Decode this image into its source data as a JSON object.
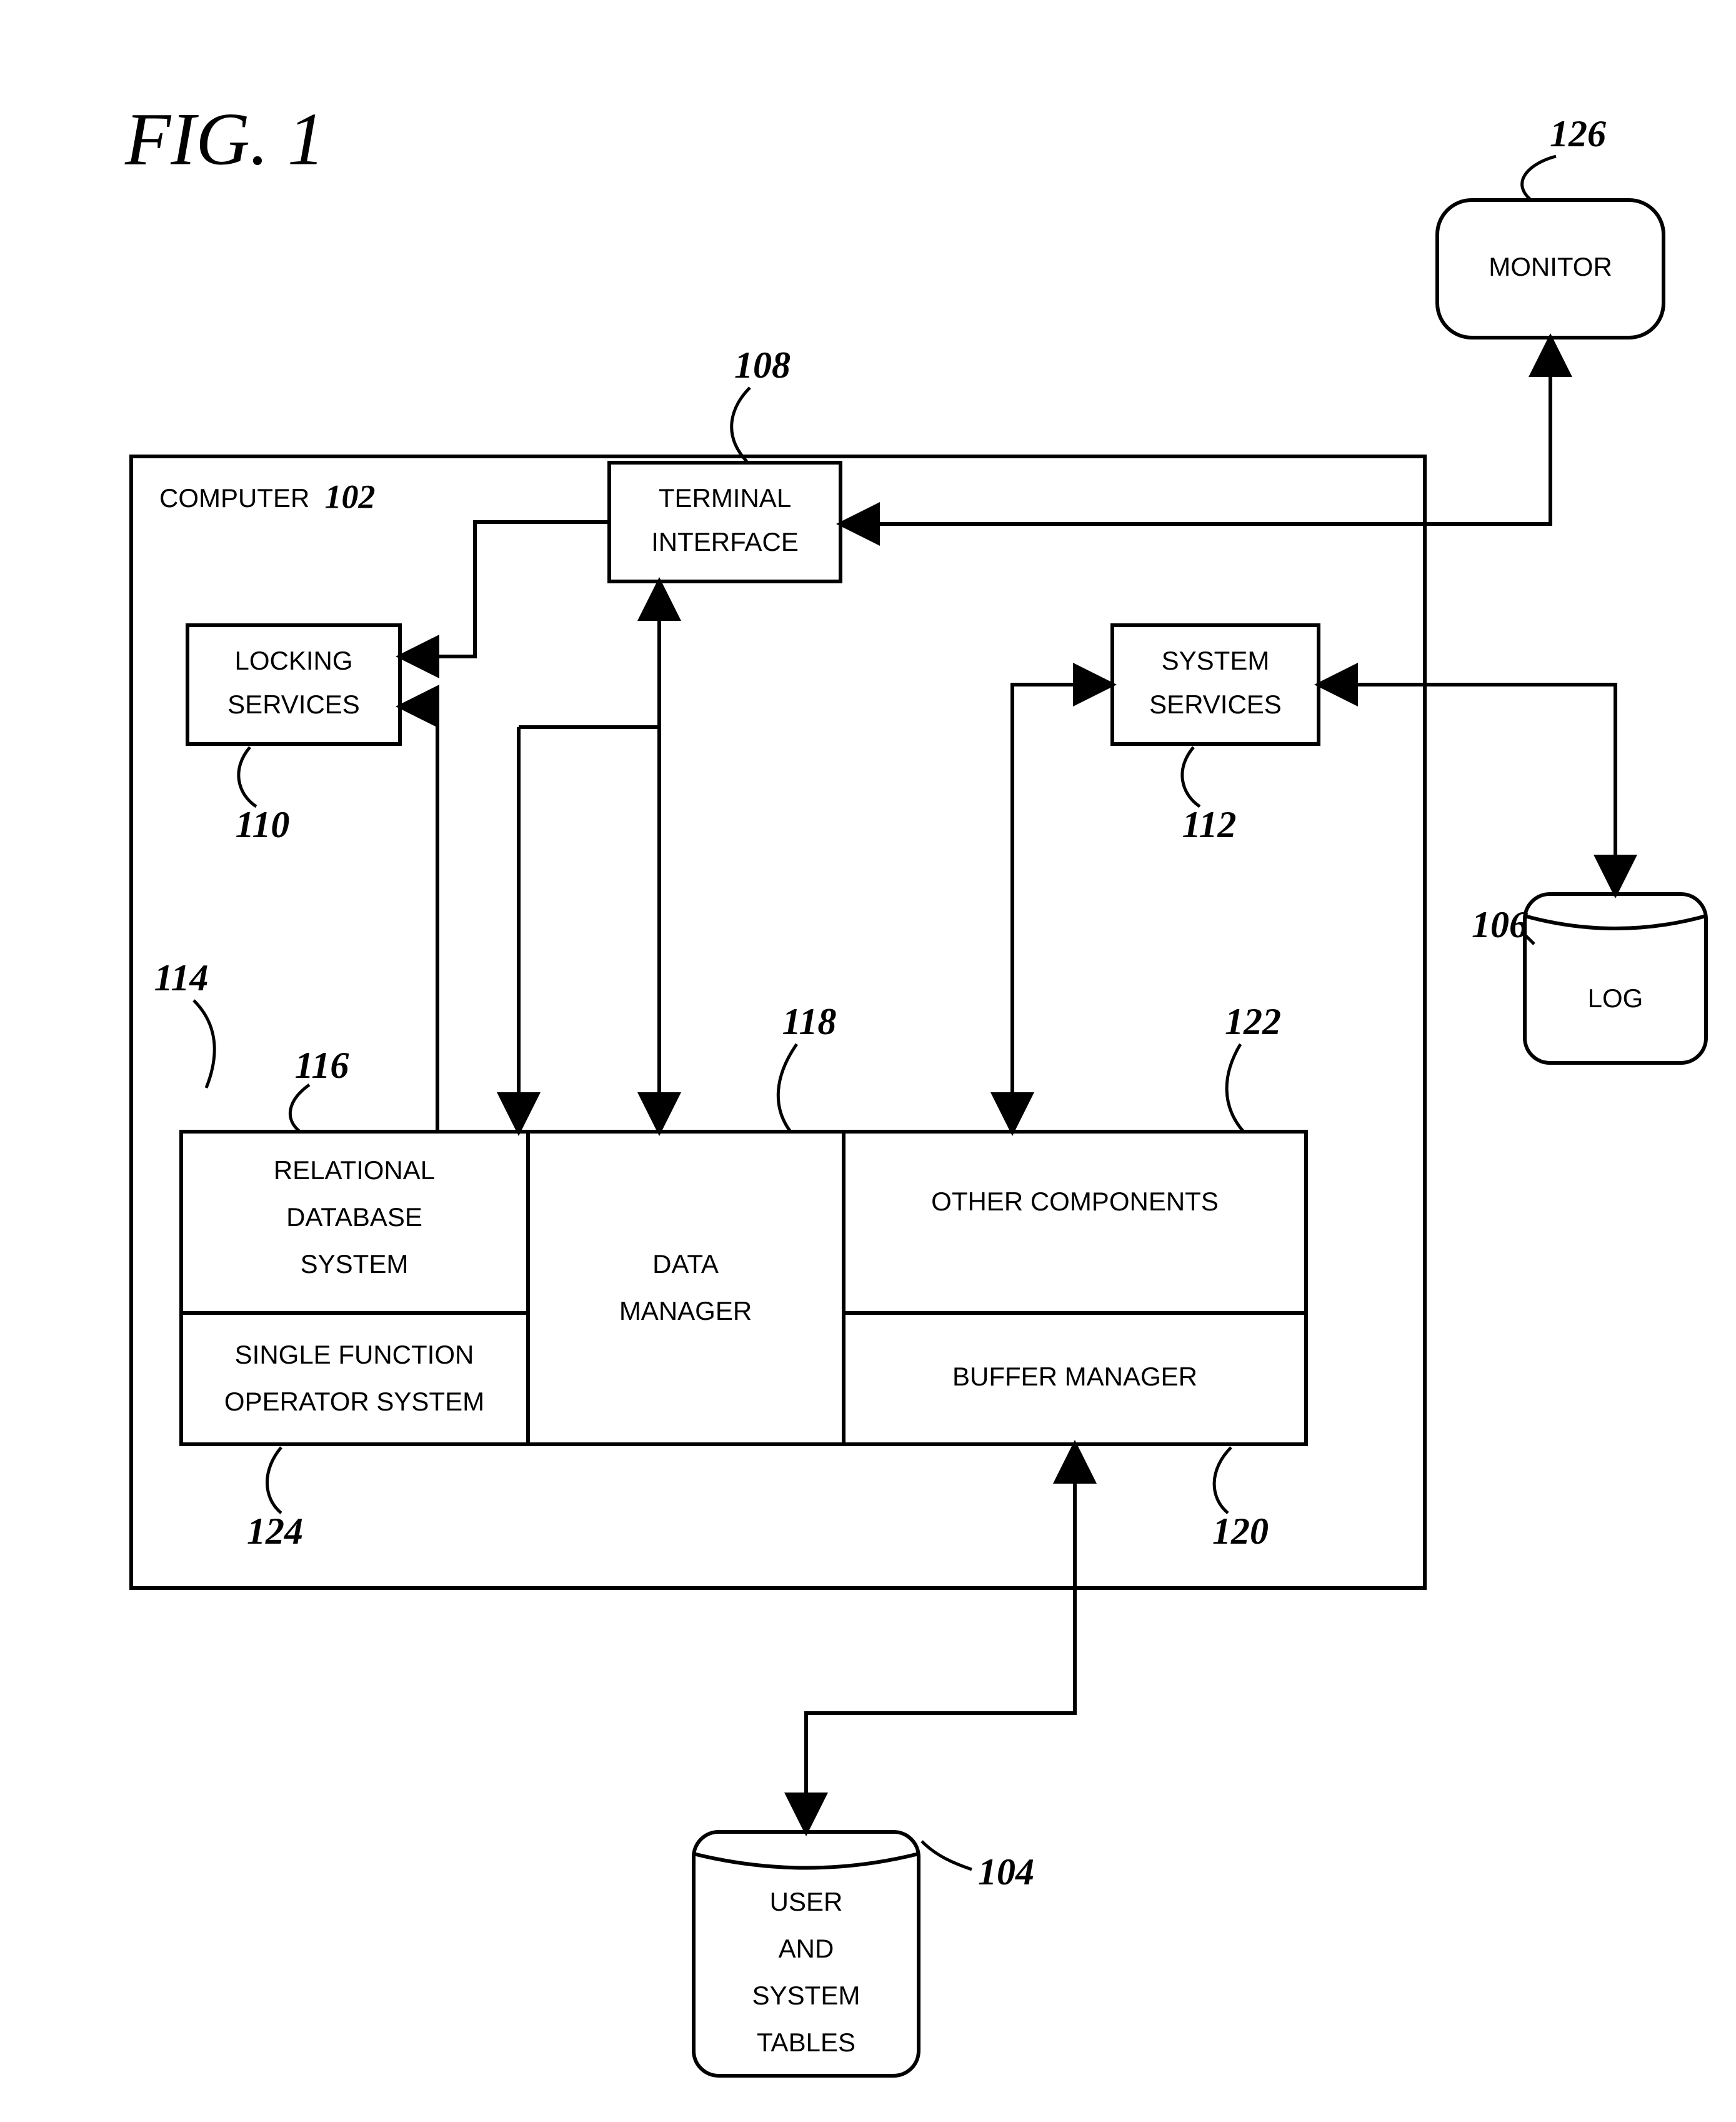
{
  "figure_title": "FIG. 1",
  "computer": {
    "label": "COMPUTER",
    "ref": "102"
  },
  "monitor": {
    "label": "MONITOR",
    "ref": "126"
  },
  "log": {
    "label": "LOG",
    "ref": "106"
  },
  "user_tables": {
    "l1": "USER",
    "l2": "AND",
    "l3": "SYSTEM",
    "l4": "TABLES",
    "ref": "104"
  },
  "terminal_interface": {
    "l1": "TERMINAL",
    "l2": "INTERFACE",
    "ref": "108"
  },
  "locking_services": {
    "l1": "LOCKING",
    "l2": "SERVICES",
    "ref": "110"
  },
  "system_services": {
    "l1": "SYSTEM",
    "l2": "SERVICES",
    "ref": "112"
  },
  "subsystem_ref": "114",
  "rds": {
    "l1": "RELATIONAL",
    "l2": "DATABASE",
    "l3": "SYSTEM",
    "ref": "116"
  },
  "data_manager": {
    "l1": "DATA",
    "l2": "MANAGER",
    "ref": "118"
  },
  "other_components": {
    "label": "OTHER COMPONENTS",
    "ref": "122"
  },
  "buffer_manager": {
    "label": "BUFFER MANAGER",
    "ref": "120"
  },
  "sfo": {
    "l1": "SINGLE FUNCTION",
    "l2": "OPERATOR SYSTEM",
    "ref": "124"
  }
}
